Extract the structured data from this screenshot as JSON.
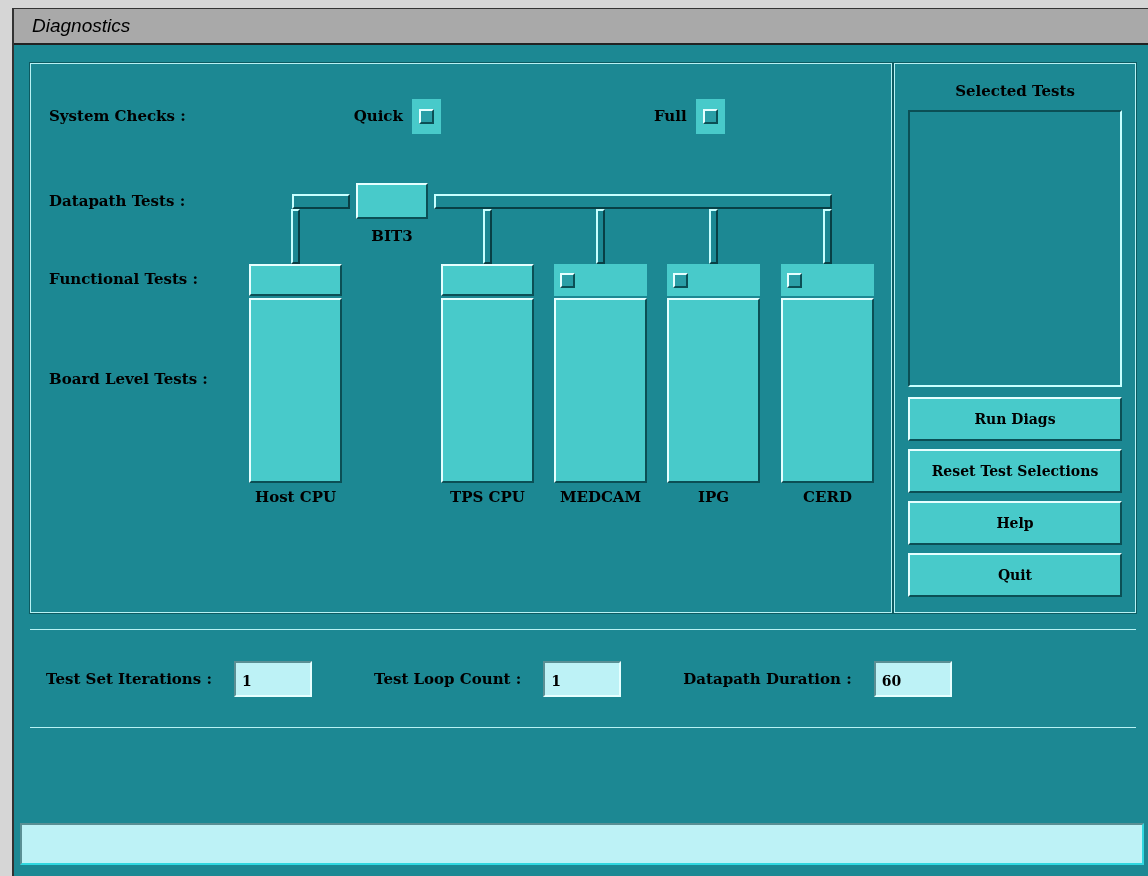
{
  "window": {
    "title": "Diagnostics"
  },
  "system_checks": {
    "label": "System Checks :",
    "options": [
      {
        "label": "Quick",
        "checked": false
      },
      {
        "label": "Full",
        "checked": false
      }
    ]
  },
  "row_labels": [
    "Datapath Tests :",
    "Functional Tests :",
    "Board Level Tests :"
  ],
  "datapath": {
    "bus_node": "BIT3"
  },
  "boards": [
    {
      "name": "Host CPU",
      "kind": "plain"
    },
    {
      "name": "TPS CPU",
      "kind": "plain"
    },
    {
      "name": "MEDCAM",
      "kind": "checkbox",
      "checked": false
    },
    {
      "name": "IPG",
      "kind": "checkbox",
      "checked": false
    },
    {
      "name": "CERD",
      "kind": "checkbox",
      "checked": false
    }
  ],
  "selected_tests": {
    "title": "Selected Tests"
  },
  "buttons": [
    "Run Diags",
    "Reset Test Selections",
    "Help",
    "Quit"
  ],
  "settings": [
    {
      "label": "Test Set Iterations :",
      "value": "1"
    },
    {
      "label": "Test Loop Count :",
      "value": "1"
    },
    {
      "label": "Datapath Duration :",
      "value": "60"
    }
  ]
}
